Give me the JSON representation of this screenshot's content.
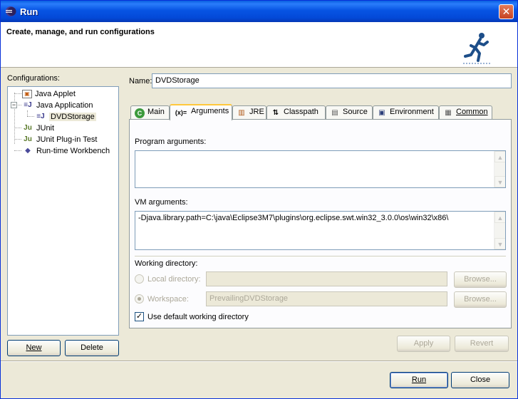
{
  "window": {
    "title": "Run",
    "close_glyph": "✕"
  },
  "header": {
    "description": "Create, manage, and run configurations"
  },
  "sidebar": {
    "label": "Configurations:",
    "items": [
      {
        "label": "Java Applet",
        "icon": "java-applet-icon"
      },
      {
        "label": "Java Application",
        "icon": "java-application-icon",
        "expanded": true
      },
      {
        "label": "DVDStorage",
        "icon": "java-launch-icon",
        "selected": true
      },
      {
        "label": "JUnit",
        "icon": "junit-icon"
      },
      {
        "label": "JUnit Plug-in Test",
        "icon": "junit-plugin-icon"
      },
      {
        "label": "Run-time Workbench",
        "icon": "workbench-icon"
      }
    ],
    "new_button": "New",
    "delete_button": "Delete"
  },
  "form": {
    "name_label": "Name:",
    "name_value": "DVDStorage"
  },
  "tabs": [
    {
      "label": "Main",
      "icon": "main-tab-icon"
    },
    {
      "label": "Arguments",
      "icon": "arguments-tab-icon",
      "active": true
    },
    {
      "label": "JRE",
      "icon": "jre-tab-icon"
    },
    {
      "label": "Classpath",
      "icon": "classpath-tab-icon"
    },
    {
      "label": "Source",
      "icon": "source-tab-icon"
    },
    {
      "label": "Environment",
      "icon": "environment-tab-icon"
    },
    {
      "label": "Common",
      "icon": "common-tab-icon"
    }
  ],
  "arguments": {
    "program_label": "Program arguments:",
    "program_value": "",
    "vm_label": "VM arguments:",
    "vm_value": "-Djava.library.path=C:\\java\\Eclipse3M7\\plugins\\org.eclipse.swt.win32_3.0.0\\os\\win32\\x86\\",
    "working_dir_label": "Working directory:",
    "local_dir_label": "Local directory:",
    "local_dir_value": "",
    "workspace_label": "Workspace:",
    "workspace_value": "PrevailingDVDStorage",
    "browse_label": "Browse...",
    "use_default_label": "Use default working directory",
    "use_default_checked": true
  },
  "buttons": {
    "apply": "Apply",
    "revert": "Revert",
    "run": "Run",
    "close": "Close"
  }
}
